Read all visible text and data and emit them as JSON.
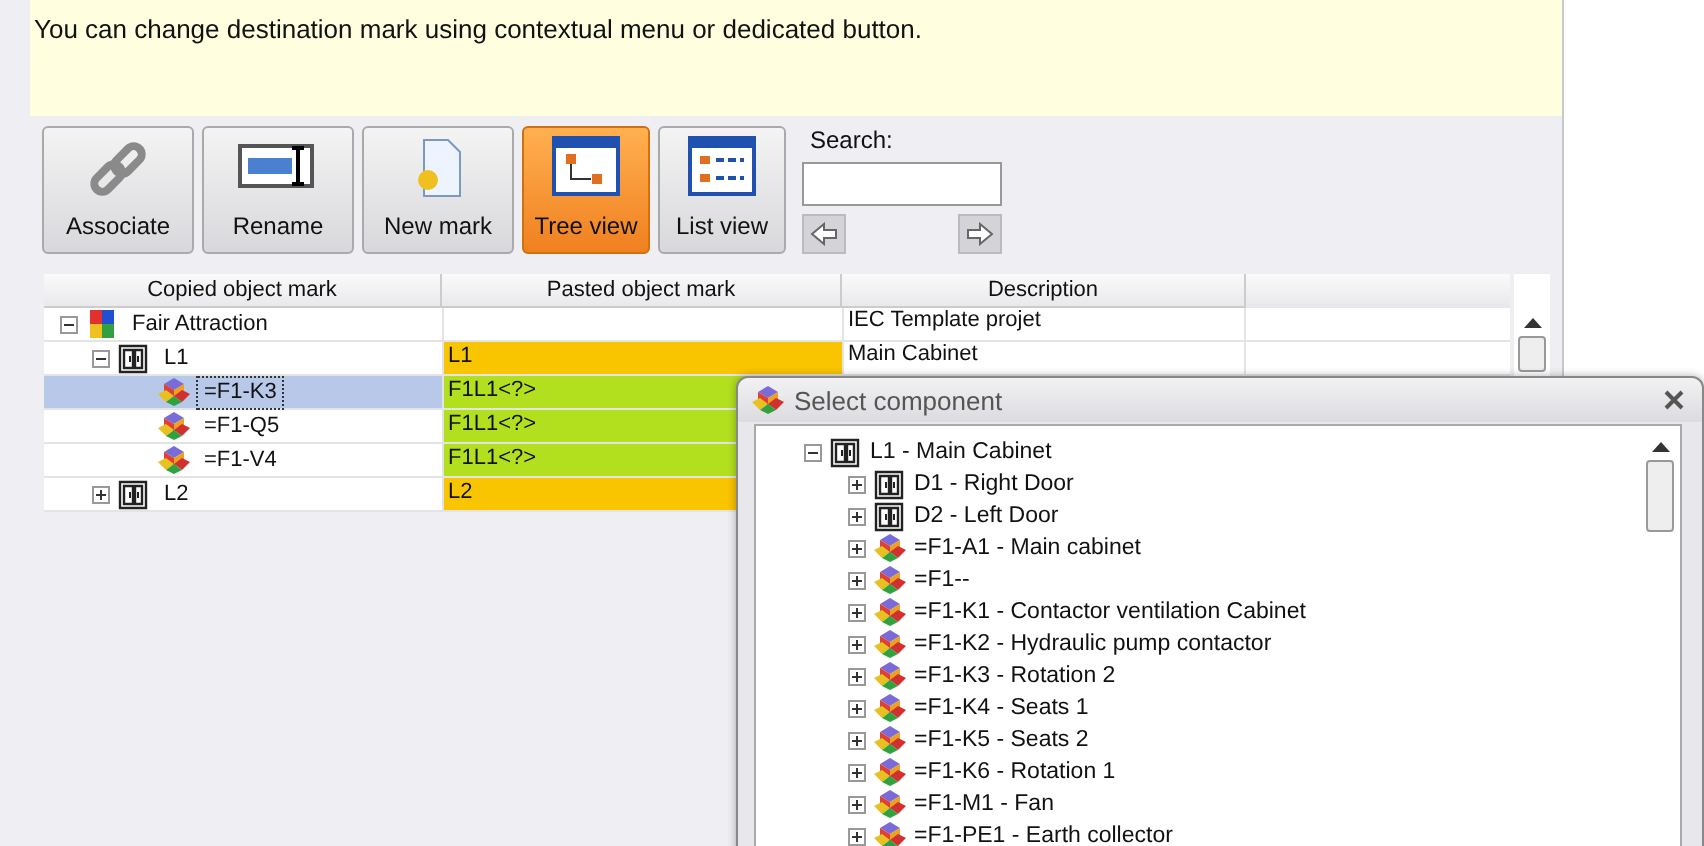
{
  "info_text": "You can change destination mark using contextual menu or dedicated button.",
  "toolbar": {
    "buttons": [
      {
        "label": "Associate",
        "kind": "associate",
        "selected": false
      },
      {
        "label": "Rename",
        "kind": "rename",
        "selected": false
      },
      {
        "label": "New mark",
        "kind": "new",
        "selected": false
      },
      {
        "label": "Tree view",
        "kind": "tree",
        "selected": true
      },
      {
        "label": "List view",
        "kind": "list",
        "selected": false
      }
    ],
    "search": {
      "label": "Search:"
    }
  },
  "table": {
    "columns": [
      "Copied object mark",
      "Pasted object mark",
      "Description"
    ],
    "rows": [
      {
        "mark": "Fair Attraction",
        "kind": "project",
        "expanded": true,
        "selected": false,
        "description": "IEC Template projet",
        "children": [
          {
            "mark": "L1",
            "kind": "cabinet",
            "expanded": true,
            "selected": false,
            "pasted": "L1",
            "color": "#f9c400",
            "description": "Main Cabinet",
            "children": [
              {
                "mark": "=F1-K3",
                "kind": "component",
                "selected": true,
                "pasted": "F1L1<?>",
                "color": "#b3e01e"
              },
              {
                "mark": "=F1-Q5",
                "kind": "component",
                "selected": false,
                "pasted": "F1L1<?>",
                "color": "#b3e01e"
              },
              {
                "mark": "=F1-V4",
                "kind": "component",
                "selected": false,
                "pasted": "F1L1<?>",
                "color": "#b3e01e"
              }
            ]
          },
          {
            "mark": "L2",
            "kind": "cabinet",
            "expanded": false,
            "selected": false,
            "pasted": "L2",
            "color": "#f9c400"
          }
        ]
      }
    ]
  },
  "dialog": {
    "title": "Select component",
    "tree": [
      {
        "label": "L1 - Main Cabinet",
        "kind": "cabinet",
        "expanded": true,
        "children": [
          {
            "label": "D1 - Right Door",
            "kind": "cabinet",
            "expanded": false
          },
          {
            "label": "D2 - Left Door",
            "kind": "cabinet",
            "expanded": false
          },
          {
            "label": "=F1-A1 - Main cabinet",
            "kind": "component",
            "expanded": false
          },
          {
            "label": "=F1--",
            "kind": "component",
            "expanded": false
          },
          {
            "label": "=F1-K1 - Contactor ventilation Cabinet",
            "kind": "component",
            "expanded": false
          },
          {
            "label": "=F1-K2 - Hydraulic pump contactor",
            "kind": "component",
            "expanded": false
          },
          {
            "label": "=F1-K3 - Rotation 2",
            "kind": "component",
            "expanded": false
          },
          {
            "label": "=F1-K4 - Seats 1",
            "kind": "component",
            "expanded": false
          },
          {
            "label": "=F1-K5 - Seats 2",
            "kind": "component",
            "expanded": false
          },
          {
            "label": "=F1-K6 - Rotation 1",
            "kind": "component",
            "expanded": false
          },
          {
            "label": "=F1-M1 - Fan",
            "kind": "component",
            "expanded": false
          },
          {
            "label": "=F1-PE1 - Earth collector",
            "kind": "component",
            "expanded": false
          }
        ]
      }
    ]
  }
}
